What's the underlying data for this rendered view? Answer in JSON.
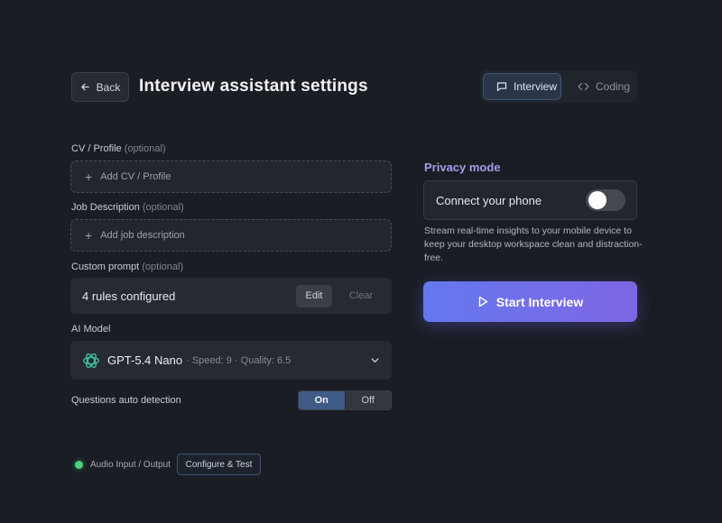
{
  "header": {
    "back_label": "Back",
    "title": "Interview assistant settings",
    "modes": [
      {
        "label": "Interview",
        "icon": "chat-bubble-icon",
        "active": true
      },
      {
        "label": "Coding",
        "icon": "code-icon",
        "active": false
      }
    ]
  },
  "form": {
    "cv": {
      "label": "CV / Profile",
      "optional": "(optional)",
      "placeholder": "Add CV / Profile"
    },
    "job": {
      "label": "Job Description",
      "optional": "(optional)",
      "placeholder": "Add job description"
    },
    "prompt": {
      "label": "Custom prompt",
      "optional": "(optional)",
      "status": "4 rules configured",
      "edit_label": "Edit",
      "clear_label": "Clear"
    },
    "model": {
      "label": "AI Model",
      "name": "GPT-5.4 Nano",
      "meta": "· Speed: 9 · Quality: 6.5",
      "icon": "openai-logo-icon"
    },
    "auto_detection": {
      "label": "Questions auto detection",
      "on_label": "On",
      "off_label": "Off",
      "value": "On"
    }
  },
  "audio": {
    "label": "Audio Input / Output",
    "status_color": "#4ad27f",
    "button_label": "Configure & Test"
  },
  "privacy": {
    "title": "Privacy mode",
    "phone_label": "Connect your phone",
    "phone_enabled": false,
    "description": "Stream real-time insights to your mobile device to keep your desktop workspace clean and distraction-free."
  },
  "start": {
    "label": "Start Interview",
    "icon": "play-icon"
  },
  "colors": {
    "accent": "#7f66e4",
    "privacy_title": "#a99be9",
    "background": "#1a1d24"
  }
}
